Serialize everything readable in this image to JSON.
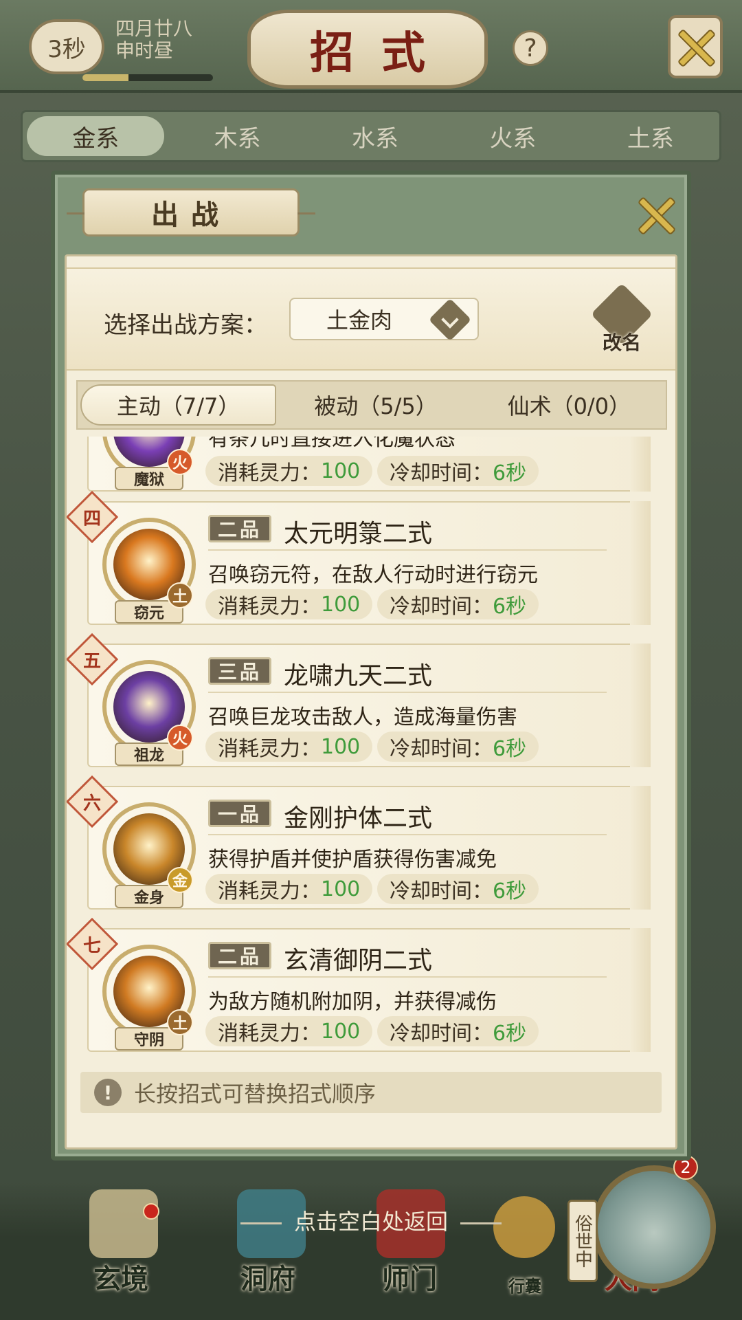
{
  "header": {
    "timer": "3秒",
    "date_line1": "四月廿八",
    "date_line2": "申时昼",
    "title": "招式",
    "help_label": "?"
  },
  "element_tabs": [
    "金系",
    "木系",
    "水系",
    "火系",
    "土系"
  ],
  "dialog": {
    "title": "出战",
    "scheme_label": "选择出战方案：",
    "scheme_value": "土金肉",
    "rename_label": "改名",
    "mode_tabs": [
      "主动（7/7）",
      "被动（5/5）",
      "仙术（0/0）"
    ],
    "hint": "长按招式可替换招式顺序",
    "hint_icon": "!",
    "cost_label": "消耗灵力：",
    "cooldown_label": "冷却时间：",
    "skills": [
      {
        "order": "",
        "grade": "",
        "name": "",
        "desc": "有条几时直接进入化魔状态",
        "portrait": "魔狱",
        "element": "火",
        "cost": "100",
        "cooldown": "6秒",
        "color": "#7a3fb5"
      },
      {
        "order": "四",
        "grade": "二品",
        "name": "太元明箓二式",
        "desc": "召唤窃元符，在敌人行动时进行窃元",
        "portrait": "窃元",
        "element": "土",
        "cost": "100",
        "cooldown": "6秒",
        "color": "#d9781f"
      },
      {
        "order": "五",
        "grade": "三品",
        "name": "龙啸九天二式",
        "desc": "召唤巨龙攻击敌人，造成海量伤害",
        "portrait": "祖龙",
        "element": "火",
        "cost": "100",
        "cooldown": "6秒",
        "color": "#6c3fa3"
      },
      {
        "order": "六",
        "grade": "一品",
        "name": "金刚护体二式",
        "desc": "获得护盾并使护盾获得伤害减免",
        "portrait": "金身",
        "element": "金",
        "cost": "100",
        "cooldown": "6秒",
        "color": "#c9862a"
      },
      {
        "order": "七",
        "grade": "二品",
        "name": "玄清御阴二式",
        "desc": "为敌方随机附加阴，并获得减伤",
        "portrait": "守阴",
        "element": "土",
        "cost": "100",
        "cooldown": "6秒",
        "color": "#d07a22"
      }
    ]
  },
  "bottom": {
    "return_hint": "点击空白处返回",
    "nav": [
      "玄境",
      "洞府",
      "师门",
      "行囊",
      "人间"
    ],
    "mortal_tag": "俗世中",
    "badge": "2"
  },
  "colors": {
    "accent_green": "#3f9b3b",
    "order_red": "#a3331c",
    "panel": "#f4eedb"
  }
}
